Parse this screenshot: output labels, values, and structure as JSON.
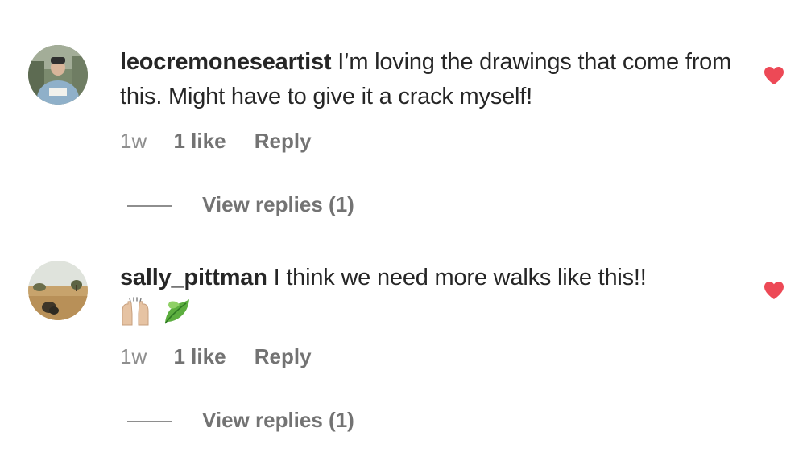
{
  "colors": {
    "text": "#262626",
    "meta": "#8e8e8e",
    "heart_liked": "#ed4956"
  },
  "comments": [
    {
      "username": "leocremoneseartist",
      "text": "I’m loving the drawings that come from this. Might have to give it a crack myself!",
      "emojis": [],
      "time": "1w",
      "likes": "1 like",
      "reply_label": "Reply",
      "view_replies": "View replies (1)",
      "liked": true,
      "heart_icon": "heart-filled-icon"
    },
    {
      "username": "sally_pittman",
      "text": "I think we need more walks like this!!",
      "emojis": [
        "raising-hands-emoji",
        "leaf-emoji"
      ],
      "time": "1w",
      "likes": "1 like",
      "reply_label": "Reply",
      "view_replies": "View replies (1)",
      "liked": true,
      "heart_icon": "heart-filled-icon"
    }
  ]
}
